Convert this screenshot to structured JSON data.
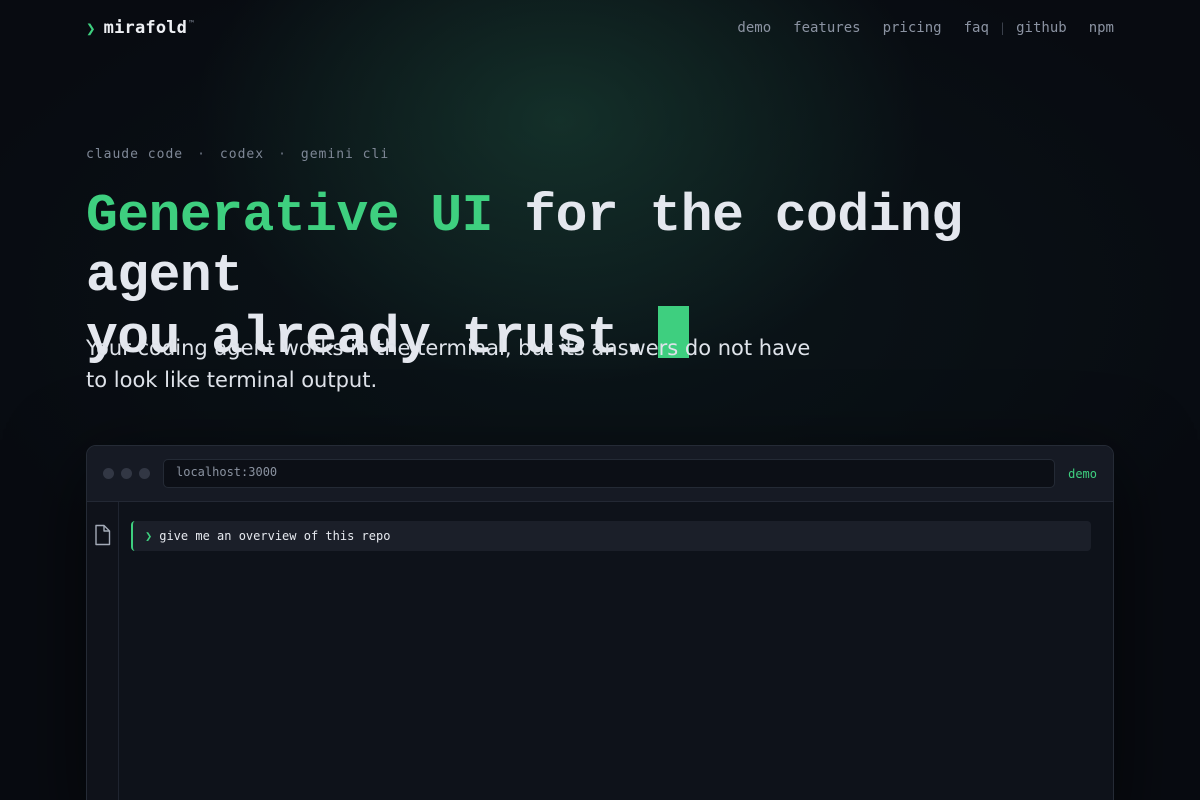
{
  "nav": {
    "brand_symbol": "❯",
    "brand_name": "mirafold",
    "brand_mark": "™",
    "links": [
      "demo",
      "features",
      "pricing",
      "faq",
      "github",
      "npm"
    ],
    "separator": "|"
  },
  "hero": {
    "eyebrow": [
      "claude code",
      "codex",
      "gemini cli"
    ],
    "eyebrow_separator": "·",
    "headline_accent": "Generative UI",
    "headline_rest_line1": " for the coding agent",
    "headline_line2": "you already trust.",
    "subhead": "Your coding agent works in the terminal, but its answers do not have to look like terminal output."
  },
  "demo_window": {
    "url": "localhost:3000",
    "tag": "demo",
    "sidebar_icon": "file-icon",
    "prompt_symbol": "❯",
    "prompt_text": "give me an overview of this repo"
  },
  "colors": {
    "accent": "#3ecf7f",
    "background": "#080b11",
    "text": "#e4e7ee",
    "muted": "#8b93a2"
  }
}
